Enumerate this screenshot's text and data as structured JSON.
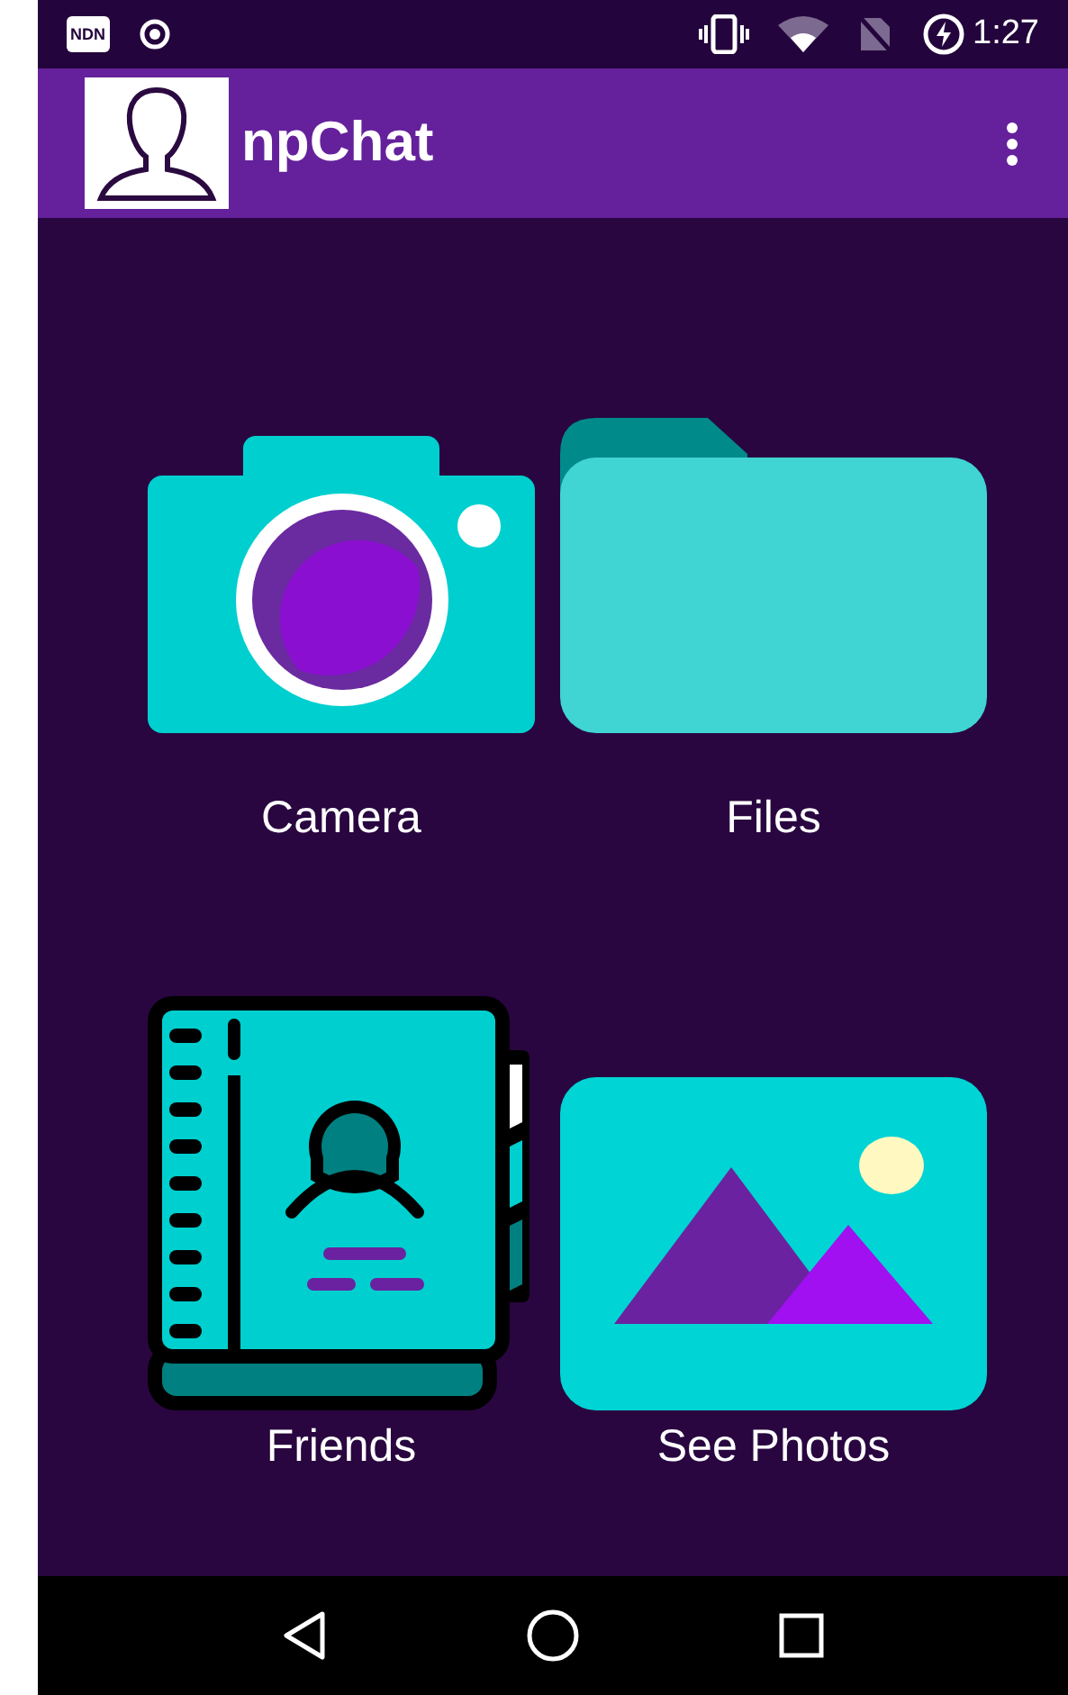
{
  "status_bar": {
    "badge": "NDN",
    "time": "1:27"
  },
  "app_bar": {
    "title": "npChat"
  },
  "tiles": [
    {
      "kind": "camera",
      "label": "Camera"
    },
    {
      "kind": "files",
      "label": "Files"
    },
    {
      "kind": "friends",
      "label": "Friends"
    },
    {
      "kind": "photos",
      "label": "See Photos"
    }
  ]
}
